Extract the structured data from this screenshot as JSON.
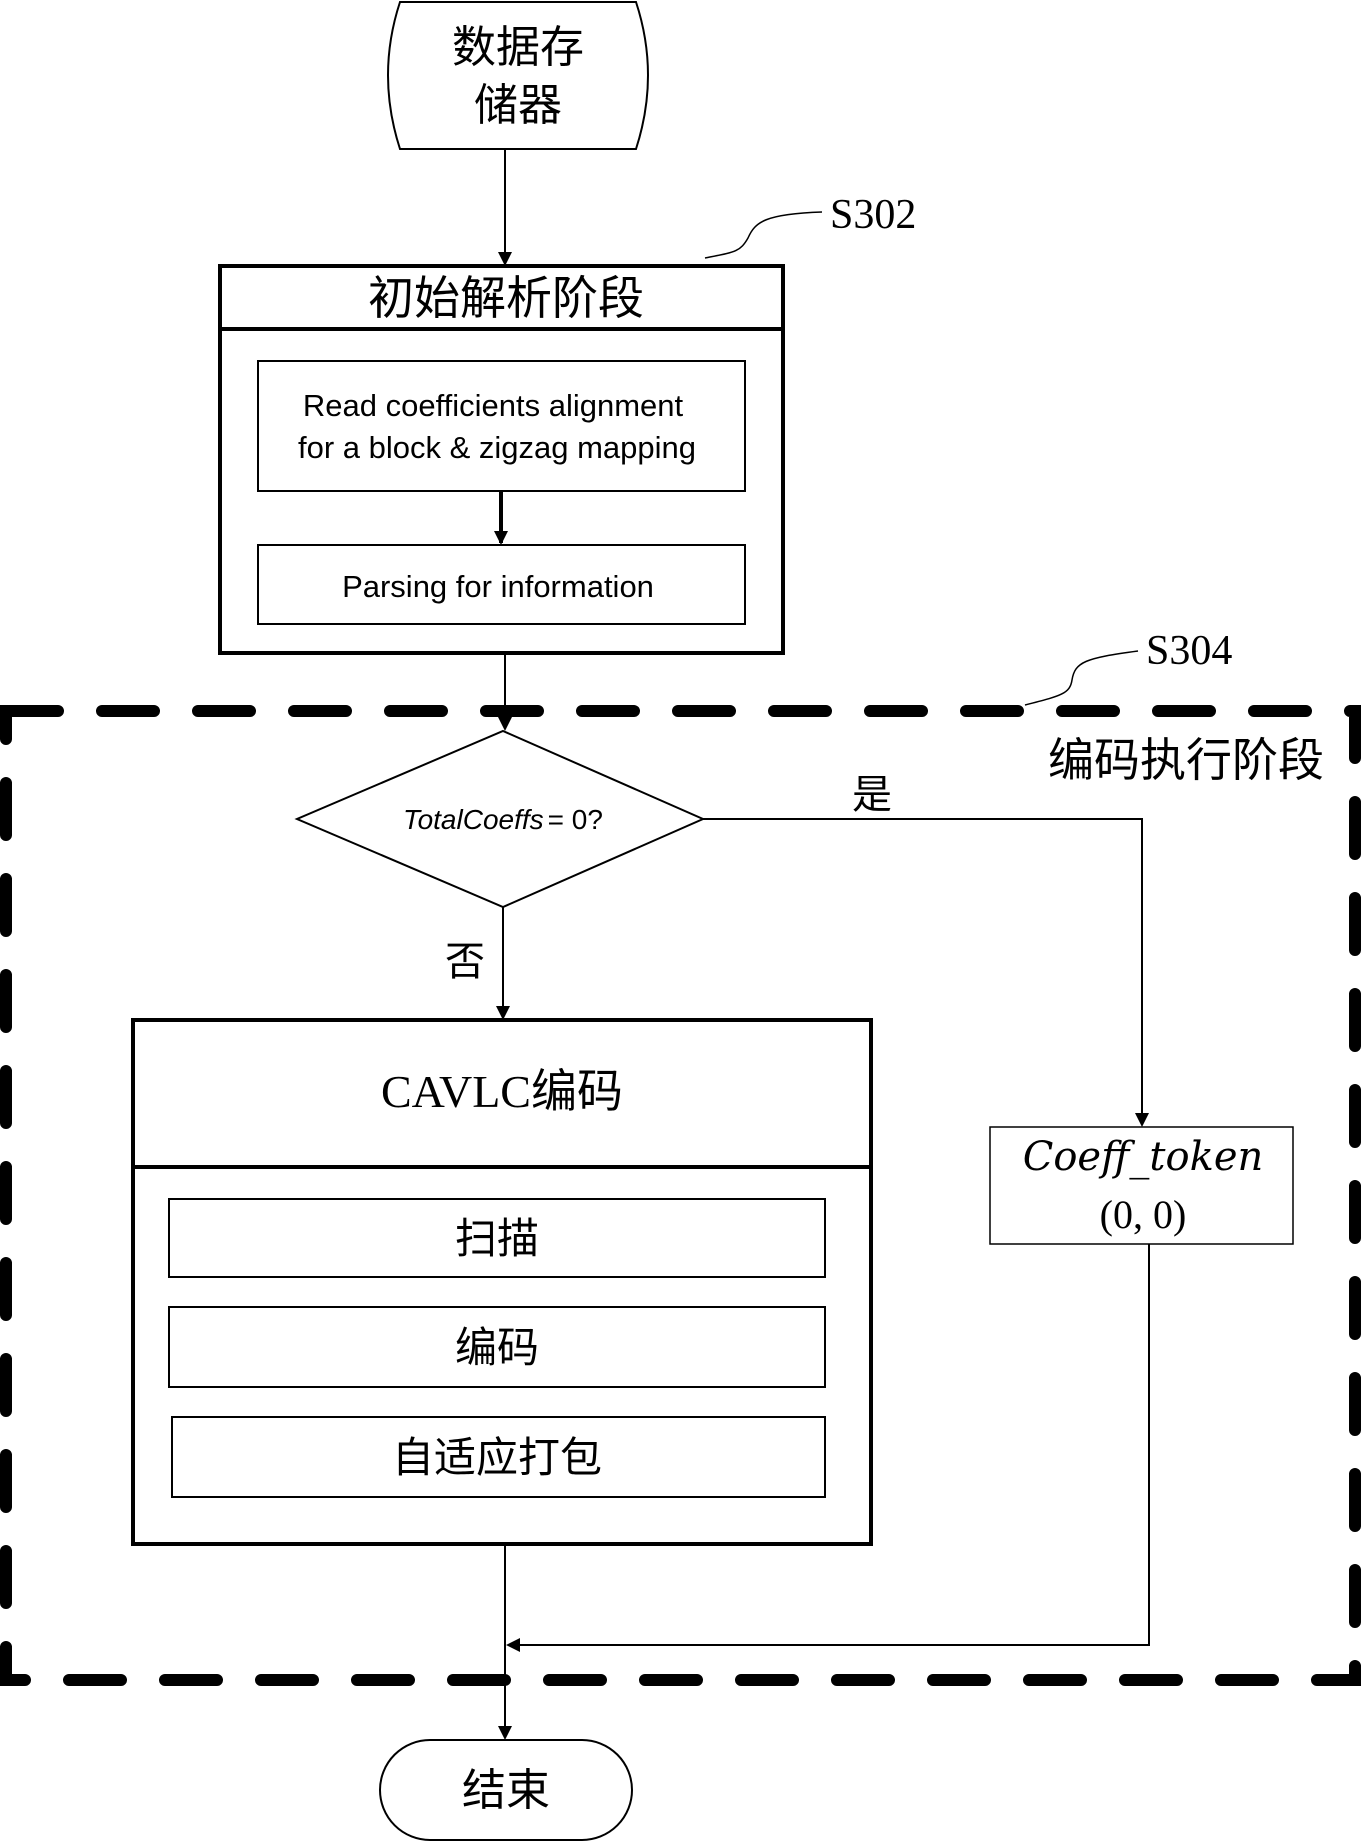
{
  "start_node": {
    "line1": "数据存",
    "line2": "储器"
  },
  "stage1": {
    "ref_label": "S302",
    "title": "初始解析阶段",
    "step1_line1": "Read coefficients alignment",
    "step1_line2": "for a block  &  zigzag mapping",
    "step2": "Parsing for information"
  },
  "stage2": {
    "ref_label": "S304",
    "title": "编码执行阶段",
    "decision": {
      "var": "TotalCoeffs",
      "rest": "=  0?"
    },
    "yes_label": "是",
    "no_label": "否",
    "cavlc": {
      "title": "CAVLC编码",
      "steps": [
        "扫描",
        "编码",
        "自适应打包"
      ]
    },
    "coeff_box": {
      "line1": "Coeff_token",
      "line2": "(0, 0)"
    }
  },
  "end_node": {
    "label": "结束"
  },
  "colors": {
    "stroke": "#000000",
    "background": "#ffffff"
  }
}
